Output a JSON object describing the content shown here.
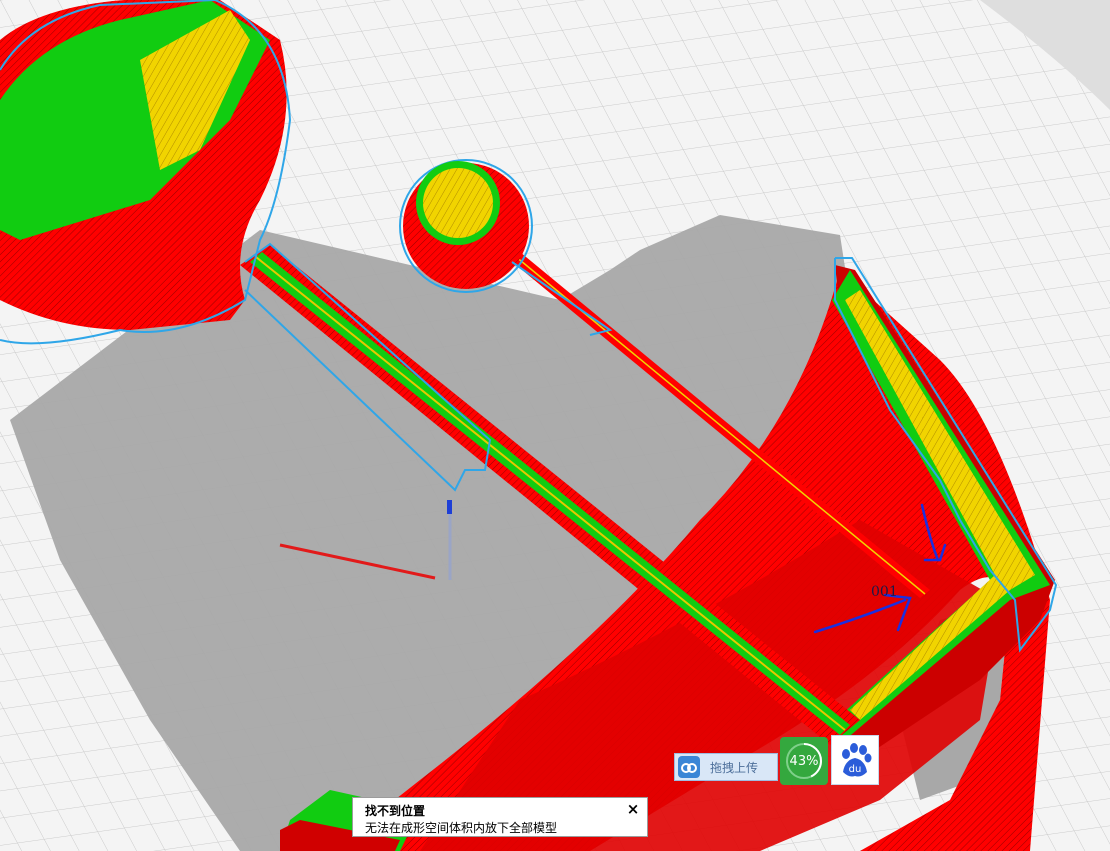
{
  "annotation": {
    "label": "001"
  },
  "upload_widget": {
    "label": "拖拽上传",
    "icon": "cloud-upload-icon"
  },
  "progress": {
    "value": 0.43,
    "text": "43%"
  },
  "baidu": {
    "logo_text": "du",
    "icon": "baidu-paw-icon"
  },
  "toast": {
    "title": "找不到位置",
    "message": "无法在成形空间体积内放下全部模型",
    "close_label": "×"
  },
  "colors": {
    "infill_red": "#ff0000",
    "infill_green": "#11cc11",
    "infill_yellow": "#e8c800",
    "outline_blue": "#2fa6e8",
    "shadow_gray": "#a8a8a8",
    "grid_bg": "#f4f4f4"
  }
}
